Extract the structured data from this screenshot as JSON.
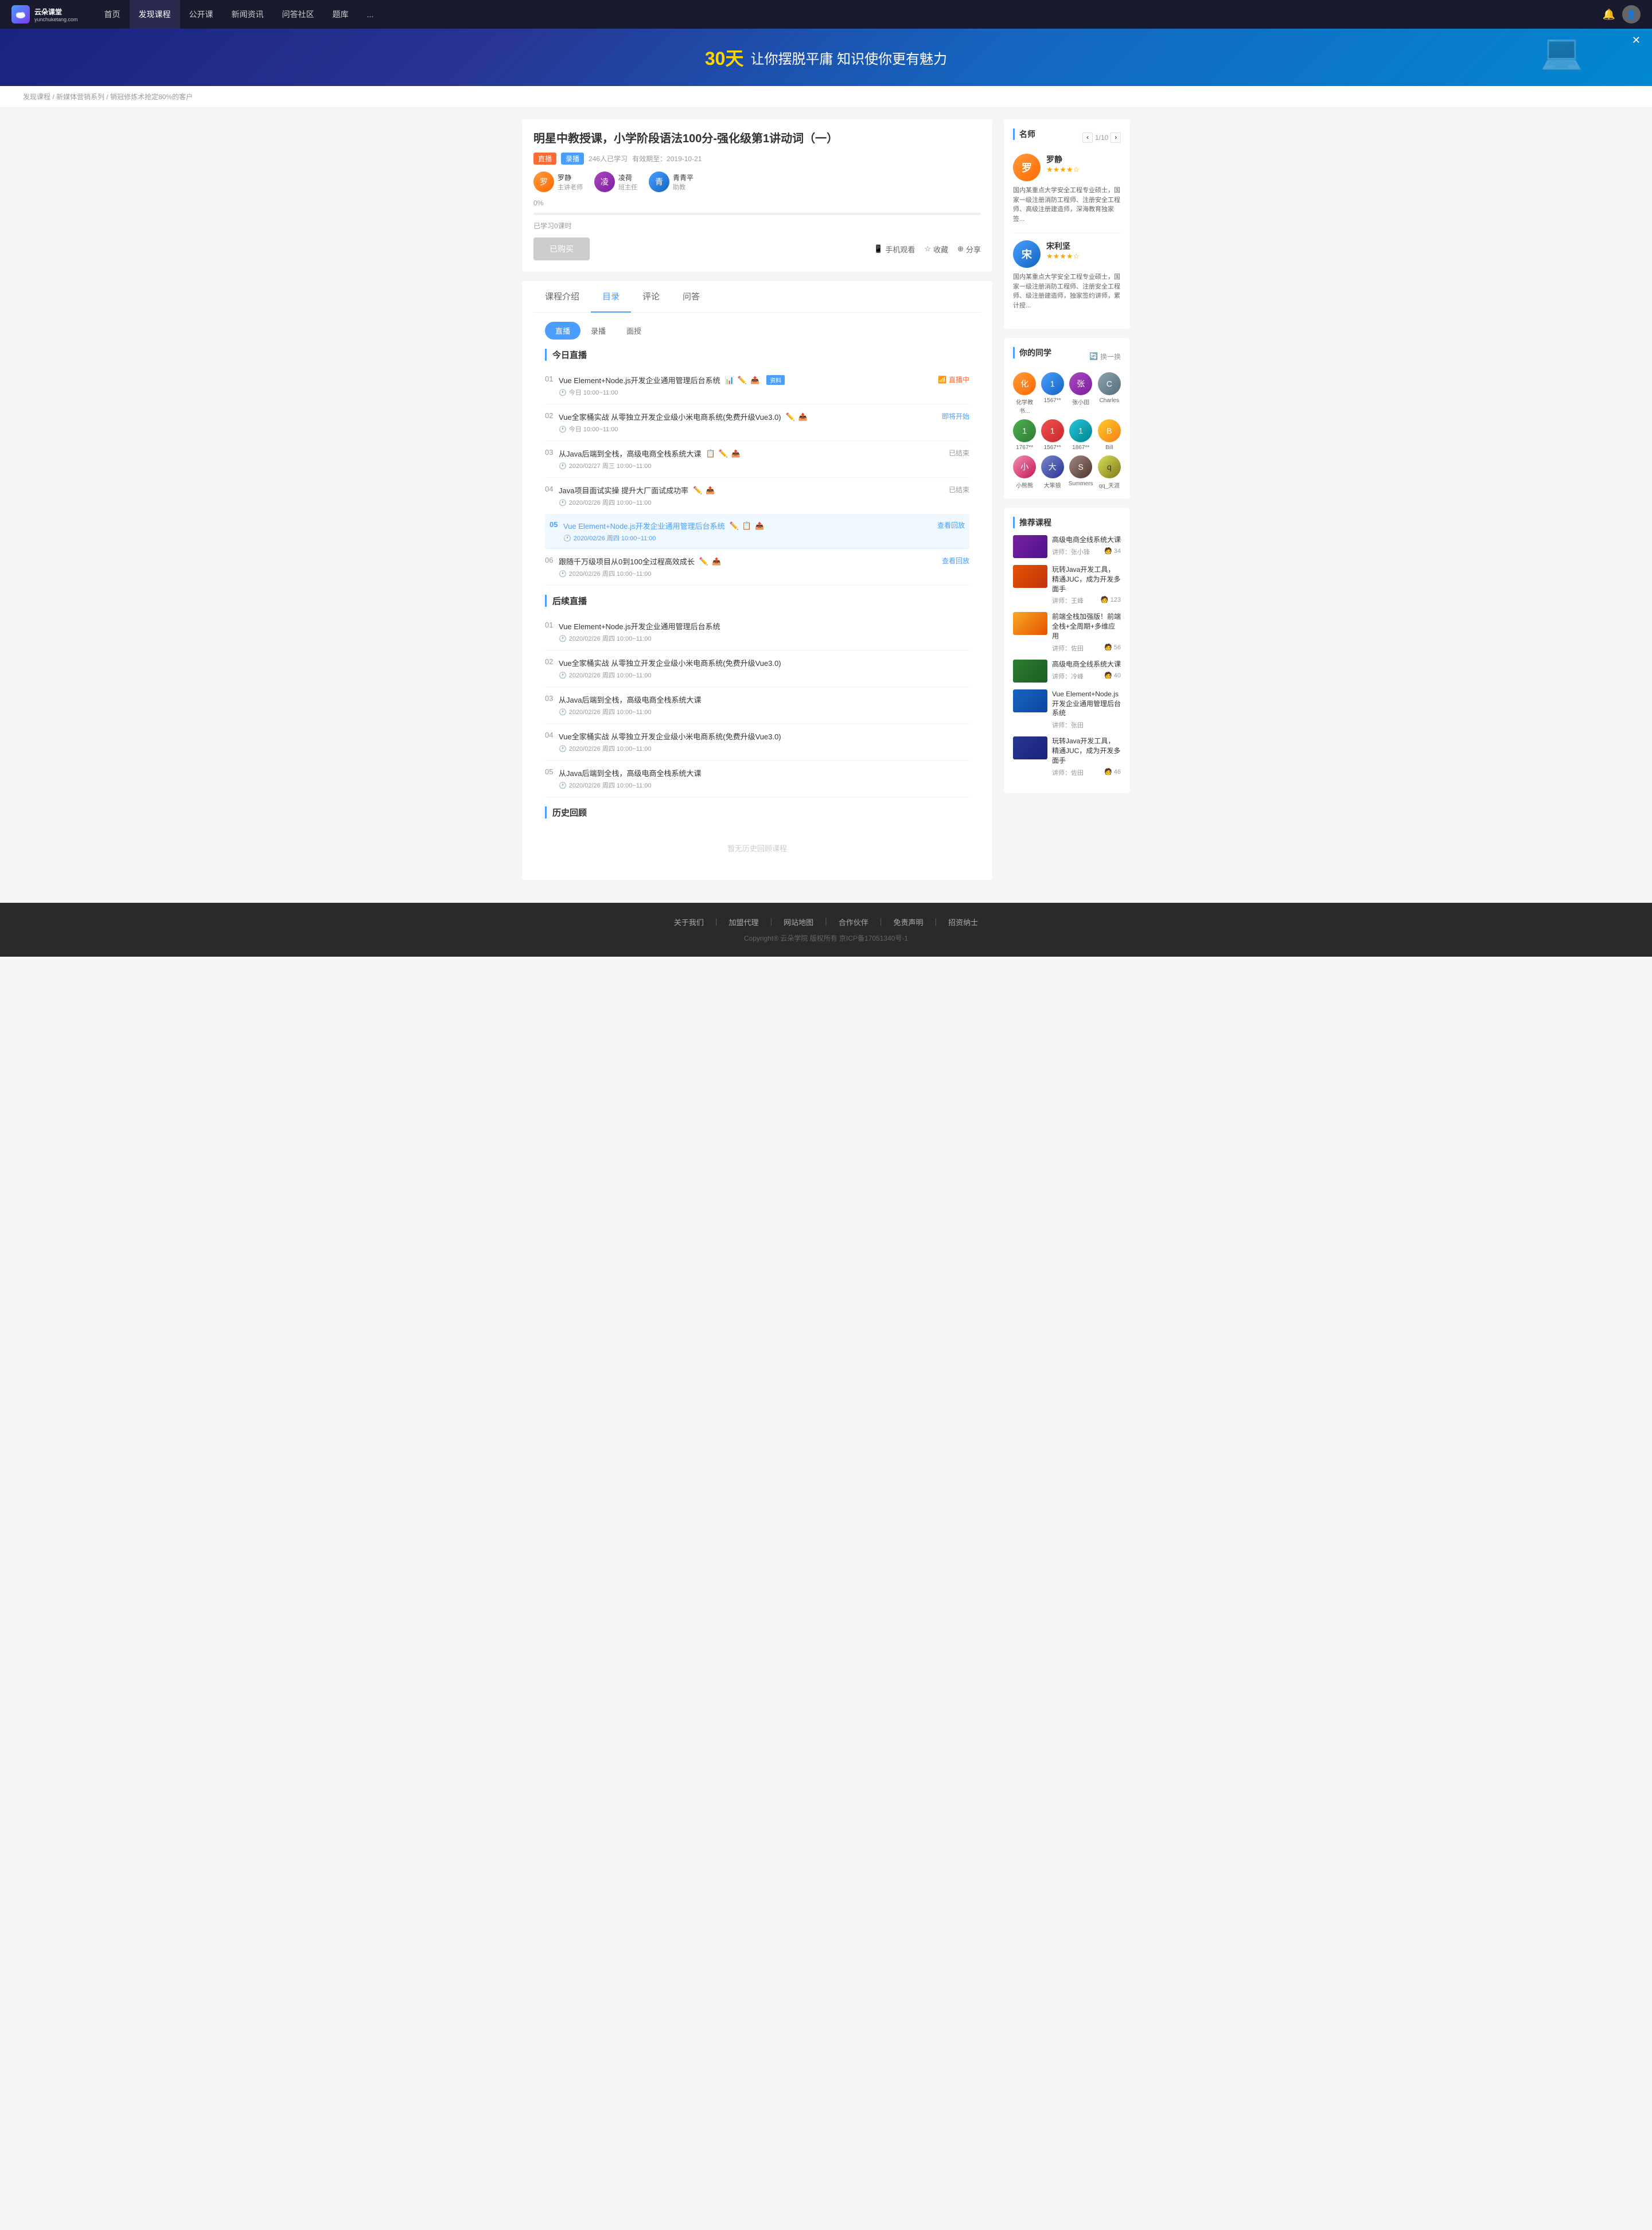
{
  "nav": {
    "logo_text": "云朵课堂",
    "logo_sub": "yunchuketang.com",
    "items": [
      {
        "label": "首页",
        "active": false
      },
      {
        "label": "发现课程",
        "active": true
      },
      {
        "label": "公开课",
        "active": false
      },
      {
        "label": "新闻资讯",
        "active": false
      },
      {
        "label": "问答社区",
        "active": false
      },
      {
        "label": "题库",
        "active": false
      },
      {
        "label": "...",
        "active": false
      }
    ]
  },
  "banner": {
    "highlight": "30天",
    "text": "让你摆脱平庸 知识使你更有魅力"
  },
  "breadcrumb": {
    "items": [
      "发现课程",
      "新媒体营销系列",
      "销冠修炼术抢定80%的客户"
    ]
  },
  "course": {
    "title": "明星中教授课，小学阶段语法100分-强化级第1讲动词（一）",
    "tags": [
      "直播",
      "录播"
    ],
    "students": "246人已学习",
    "validity": "有效期至：2019-10-21",
    "progress_percent": "0%",
    "progress_label": "已学习0课时",
    "teachers": [
      {
        "name": "罗静",
        "role": "主讲老师"
      },
      {
        "name": "凌荷",
        "role": "班主任"
      },
      {
        "name": "青青平",
        "role": "助教"
      }
    ],
    "btn_purchased": "已购买",
    "action_mobile": "手机观看",
    "action_collect": "收藏",
    "action_share": "分享"
  },
  "tabs": {
    "items": [
      "课程介绍",
      "目录",
      "评论",
      "问答"
    ],
    "active": 1
  },
  "sub_tabs": {
    "items": [
      "直播",
      "录播",
      "面授"
    ],
    "active": 0
  },
  "today_live": {
    "section": "今日直播",
    "lessons": [
      {
        "num": "01",
        "name": "Vue Element+Node.js开发企业通用管理后台系统",
        "icons": [
          "📋",
          "✏️",
          "📤"
        ],
        "material": "资料",
        "time": "今日 10:00~11:00",
        "status": "直播中",
        "status_type": "live"
      },
      {
        "num": "02",
        "name": "Vue全家桶实战 从零独立开发企业级小米电商系统(免费升级Vue3.0)",
        "icons": [
          "✏️",
          "📤"
        ],
        "time": "今日 10:00~11:00",
        "status": "即将开始",
        "status_type": "soon"
      },
      {
        "num": "03",
        "name": "从Java后端到全栈，高级电商全栈系统大课",
        "icons": [
          "📋",
          "✏️",
          "📤"
        ],
        "time": "2020/02/27 周三 10:00~11:00",
        "status": "已结束",
        "status_type": "ended"
      },
      {
        "num": "04",
        "name": "Java项目面试实操 提升大厂面试成功率",
        "icons": [
          "✏️",
          "📤"
        ],
        "time": "2020/02/26 周四 10:00~11:00",
        "status": "已结束",
        "status_type": "ended"
      },
      {
        "num": "05",
        "name": "Vue Element+Node.js开发企业通用管理后台系统",
        "icons": [
          "✏️",
          "📋",
          "📤"
        ],
        "time": "2020/02/26 周四 10:00~11:00",
        "status": "查看回放",
        "status_type": "replay",
        "highlight": true
      },
      {
        "num": "06",
        "name": "跟随千万级项目从0到100全过程高效成长",
        "icons": [
          "✏️",
          "📤"
        ],
        "time": "2020/02/26 周四 10:00~11:00",
        "status": "查看回放",
        "status_type": "replay"
      }
    ]
  },
  "future_live": {
    "section": "后续直播",
    "lessons": [
      {
        "num": "01",
        "name": "Vue Element+Node.js开发企业通用管理后台系统",
        "time": "2020/02/26 周四 10:00~11:00"
      },
      {
        "num": "02",
        "name": "Vue全家桶实战 从零独立开发企业级小米电商系统(免费升级Vue3.0)",
        "time": "2020/02/26 周四 10:00~11:00"
      },
      {
        "num": "03",
        "name": "从Java后端到全栈，高级电商全栈系统大课",
        "time": "2020/02/26 周四 10:00~11:00"
      },
      {
        "num": "04",
        "name": "Vue全家桶实战 从零独立开发企业级小米电商系统(免费升级Vue3.0)",
        "time": "2020/02/26 周四 10:00~11:00"
      },
      {
        "num": "05",
        "name": "从Java后端到全栈，高级电商全栈系统大课",
        "time": "2020/02/26 周四 10:00~11:00"
      }
    ]
  },
  "history": {
    "section": "历史回顾",
    "empty_text": "暂无历史回顾课程"
  },
  "teachers_sidebar": {
    "title": "名师",
    "pagination": "1/10",
    "teachers": [
      {
        "name": "罗静",
        "stars": 4,
        "desc": "国内某重点大学安全工程专业硕士，国家一级注册消防工程师、注册安全工程师、高级注册建造师，深海教育独家签..."
      },
      {
        "name": "宋利坚",
        "stars": 4,
        "desc": "国内某重点大学安全工程专业硕士，国家一级注册消防工程师、注册安全工程师、级注册建造师，独家签约讲师，累计授..."
      }
    ]
  },
  "classmates": {
    "title": "你的同学",
    "switch_label": "换一换",
    "items": [
      {
        "name": "化学教书...",
        "color": "av-orange"
      },
      {
        "name": "1567**",
        "color": "av-blue"
      },
      {
        "name": "张小田",
        "color": "av-purple"
      },
      {
        "name": "Charles",
        "color": "av-gray"
      },
      {
        "name": "1767**",
        "color": "av-green"
      },
      {
        "name": "1567**",
        "color": "av-red"
      },
      {
        "name": "1867**",
        "color": "av-teal"
      },
      {
        "name": "Bill",
        "color": "av-yellow"
      },
      {
        "name": "小熊熊",
        "color": "av-pink"
      },
      {
        "name": "大笨狼",
        "color": "av-indigo"
      },
      {
        "name": "Summers",
        "color": "av-brown"
      },
      {
        "name": "qq_天涯",
        "color": "av-lime"
      }
    ]
  },
  "recommended": {
    "title": "推荐课程",
    "courses": [
      {
        "title": "高级电商全线系统大课",
        "teacher": "张小锋",
        "students": "34",
        "thumb_color": "thumb-purple"
      },
      {
        "title": "玩转Java开发工具，精通JUC，成为开发多面手",
        "teacher": "王峰",
        "students": "123",
        "thumb_color": "thumb-orange"
      },
      {
        "title": "前端全栈加强版！前端全栈+全周期+多维应用",
        "teacher": "佐田",
        "students": "56",
        "thumb_color": "thumb-yellow"
      },
      {
        "title": "高级电商全线系统大课",
        "teacher": "冷峰",
        "students": "40",
        "thumb_color": "thumb-green"
      },
      {
        "title": "Vue Element+Node.js开发企业通用管理后台系统",
        "teacher": "张田",
        "students": "",
        "thumb_color": "thumb-blue"
      },
      {
        "title": "玩转Java开发工具，精通JUC，成为开发多面手",
        "teacher": "佐田",
        "students": "46",
        "thumb_color": "thumb-darkblue"
      }
    ]
  },
  "footer": {
    "links": [
      "关于我们",
      "加盟代理",
      "网站地图",
      "合作伙伴",
      "免责声明",
      "招资纳士"
    ],
    "copyright": "Copyright® 云朵学院  版权所有  京ICP备17051340号-1"
  }
}
